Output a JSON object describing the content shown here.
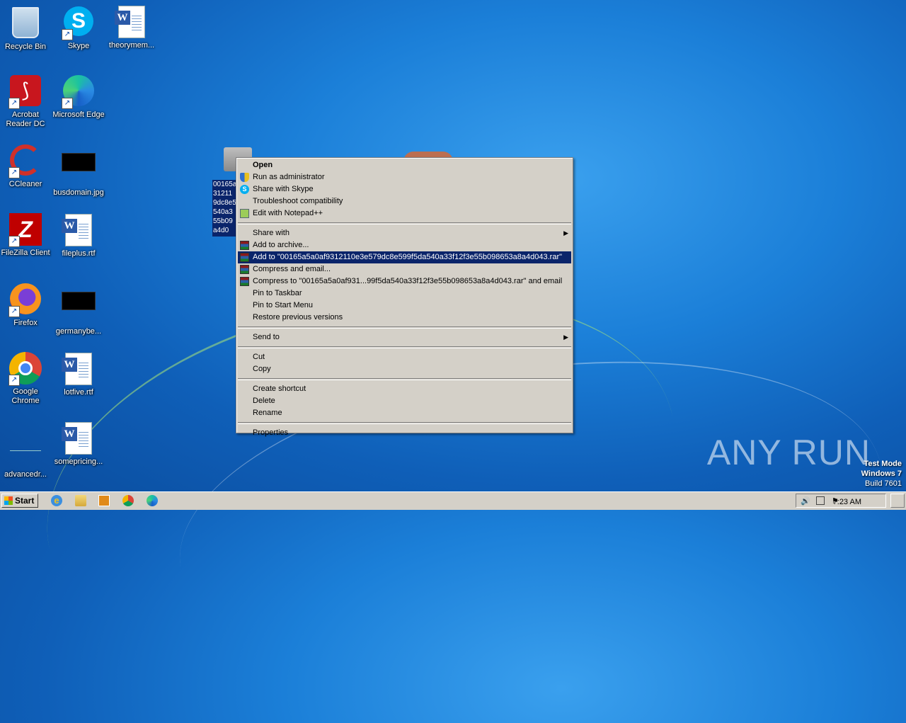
{
  "desktop": {
    "icons": [
      {
        "label": "Recycle Bin",
        "icon": "recycle-bin-icon"
      },
      {
        "label": "Skype",
        "icon": "skype-icon"
      },
      {
        "label": "theorymem...",
        "icon": "word-document-icon"
      },
      {
        "label": "Acrobat Reader DC",
        "icon": "acrobat-icon"
      },
      {
        "label": "Microsoft Edge",
        "icon": "edge-icon"
      },
      {
        "label": "CCleaner",
        "icon": "ccleaner-icon"
      },
      {
        "label": "busdomain.jpg",
        "icon": "image-file-icon"
      },
      {
        "label": "FileZilla Client",
        "icon": "filezilla-icon"
      },
      {
        "label": "fileplus.rtf",
        "icon": "word-document-icon"
      },
      {
        "label": "Firefox",
        "icon": "firefox-icon"
      },
      {
        "label": "germanybe...",
        "icon": "image-file-icon"
      },
      {
        "label": "Google Chrome",
        "icon": "chrome-icon"
      },
      {
        "label": "lotfive.rtf",
        "icon": "word-document-icon"
      },
      {
        "label": "advancedr...",
        "icon": "blank-file-icon"
      },
      {
        "label": "somepricing...",
        "icon": "word-document-icon"
      }
    ],
    "selected_file_label": "00165a 31211 9dc8e5 540a3 55b09 a4d0"
  },
  "context_menu": {
    "items": {
      "open": "Open",
      "run_as_admin": "Run as administrator",
      "share_skype": "Share with Skype",
      "troubleshoot": "Troubleshoot compatibility",
      "edit_npp": "Edit with Notepad++",
      "share_with": "Share with",
      "add_archive": "Add to archive...",
      "add_to_rar": "Add to \"00165a5a0af9312110e3e579dc8e599f5da540a33f12f3e55b098653a8a4d043.rar\"",
      "compress_email": "Compress and email...",
      "compress_to_rar_email": "Compress to \"00165a5a0af931...99f5da540a33f12f3e55b098653a8a4d043.rar\" and email",
      "pin_taskbar": "Pin to Taskbar",
      "pin_start": "Pin to Start Menu",
      "restore_versions": "Restore previous versions",
      "send_to": "Send to",
      "cut": "Cut",
      "copy": "Copy",
      "create_shortcut": "Create shortcut",
      "delete": "Delete",
      "rename": "Rename",
      "properties": "Properties"
    }
  },
  "watermark": "ANY RUN",
  "test_mode": {
    "line1": "Test Mode",
    "line2": "Windows 7",
    "line3": "Build 7601"
  },
  "taskbar": {
    "start_label": "Start",
    "clock": "7:23 AM",
    "pinned": [
      "internet-explorer-icon",
      "explorer-folder-icon",
      "media-player-icon",
      "chrome-icon",
      "edge-icon"
    ]
  },
  "colors": {
    "highlight": "#0a246a",
    "menu_bg": "#d4d0c8",
    "desktop_blue": "#1b7fd8"
  }
}
